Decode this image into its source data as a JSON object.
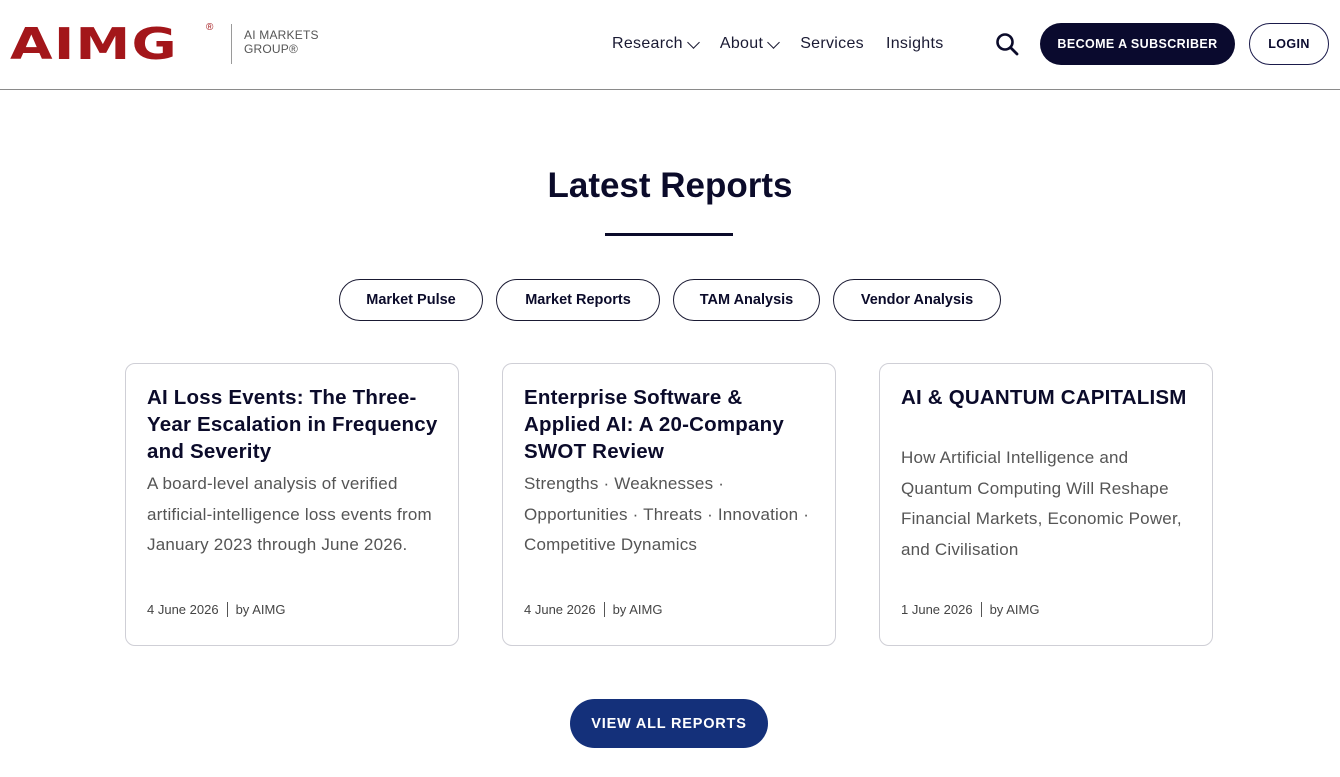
{
  "brand": {
    "logo_text": "AIMG",
    "logo_reg": "®",
    "sub_line1": "AI MARKETS",
    "sub_line2": "GROUP®",
    "color": "#a3161a"
  },
  "nav": {
    "items": [
      {
        "label": "Research",
        "has_dropdown": true
      },
      {
        "label": "About",
        "has_dropdown": true
      },
      {
        "label": "Services",
        "has_dropdown": false
      },
      {
        "label": "Insights",
        "has_dropdown": false
      }
    ],
    "search_icon": "search-icon",
    "subscribe_label": "BECOME A SUBSCRIBER",
    "login_label": "LOGIN"
  },
  "section": {
    "title": "Latest Reports",
    "filters": [
      "Market Pulse",
      "Market Reports",
      "TAM Analysis",
      "Vendor Analysis"
    ]
  },
  "reports": [
    {
      "title": "AI Loss Events: The Three-Year Escalation in Frequency and Severity",
      "description": "A board-level analysis of verified artificial-intelligence loss events from January 2023 through June 2026.",
      "date": "4 June 2026",
      "author": "by AIMG"
    },
    {
      "title": "Enterprise Software & Applied AI: A 20-Company SWOT Review",
      "description": "Strengths · Weaknesses · Opportunities · Threats · Innovation · Competitive Dynamics",
      "date": "4 June 2026",
      "author": "by AIMG"
    },
    {
      "title": "AI & QUANTUM CAPITALISM",
      "description": "How Artificial Intelligence and Quantum Computing Will Reshape Financial Markets, Economic Power, and Civilisation",
      "date": "1 June 2026",
      "author": "by AIMG"
    }
  ],
  "view_all_label": "VIEW ALL REPORTS",
  "colors": {
    "navy": "#0a0a2e",
    "button_blue": "#14307a",
    "brand_red": "#a3161a"
  }
}
